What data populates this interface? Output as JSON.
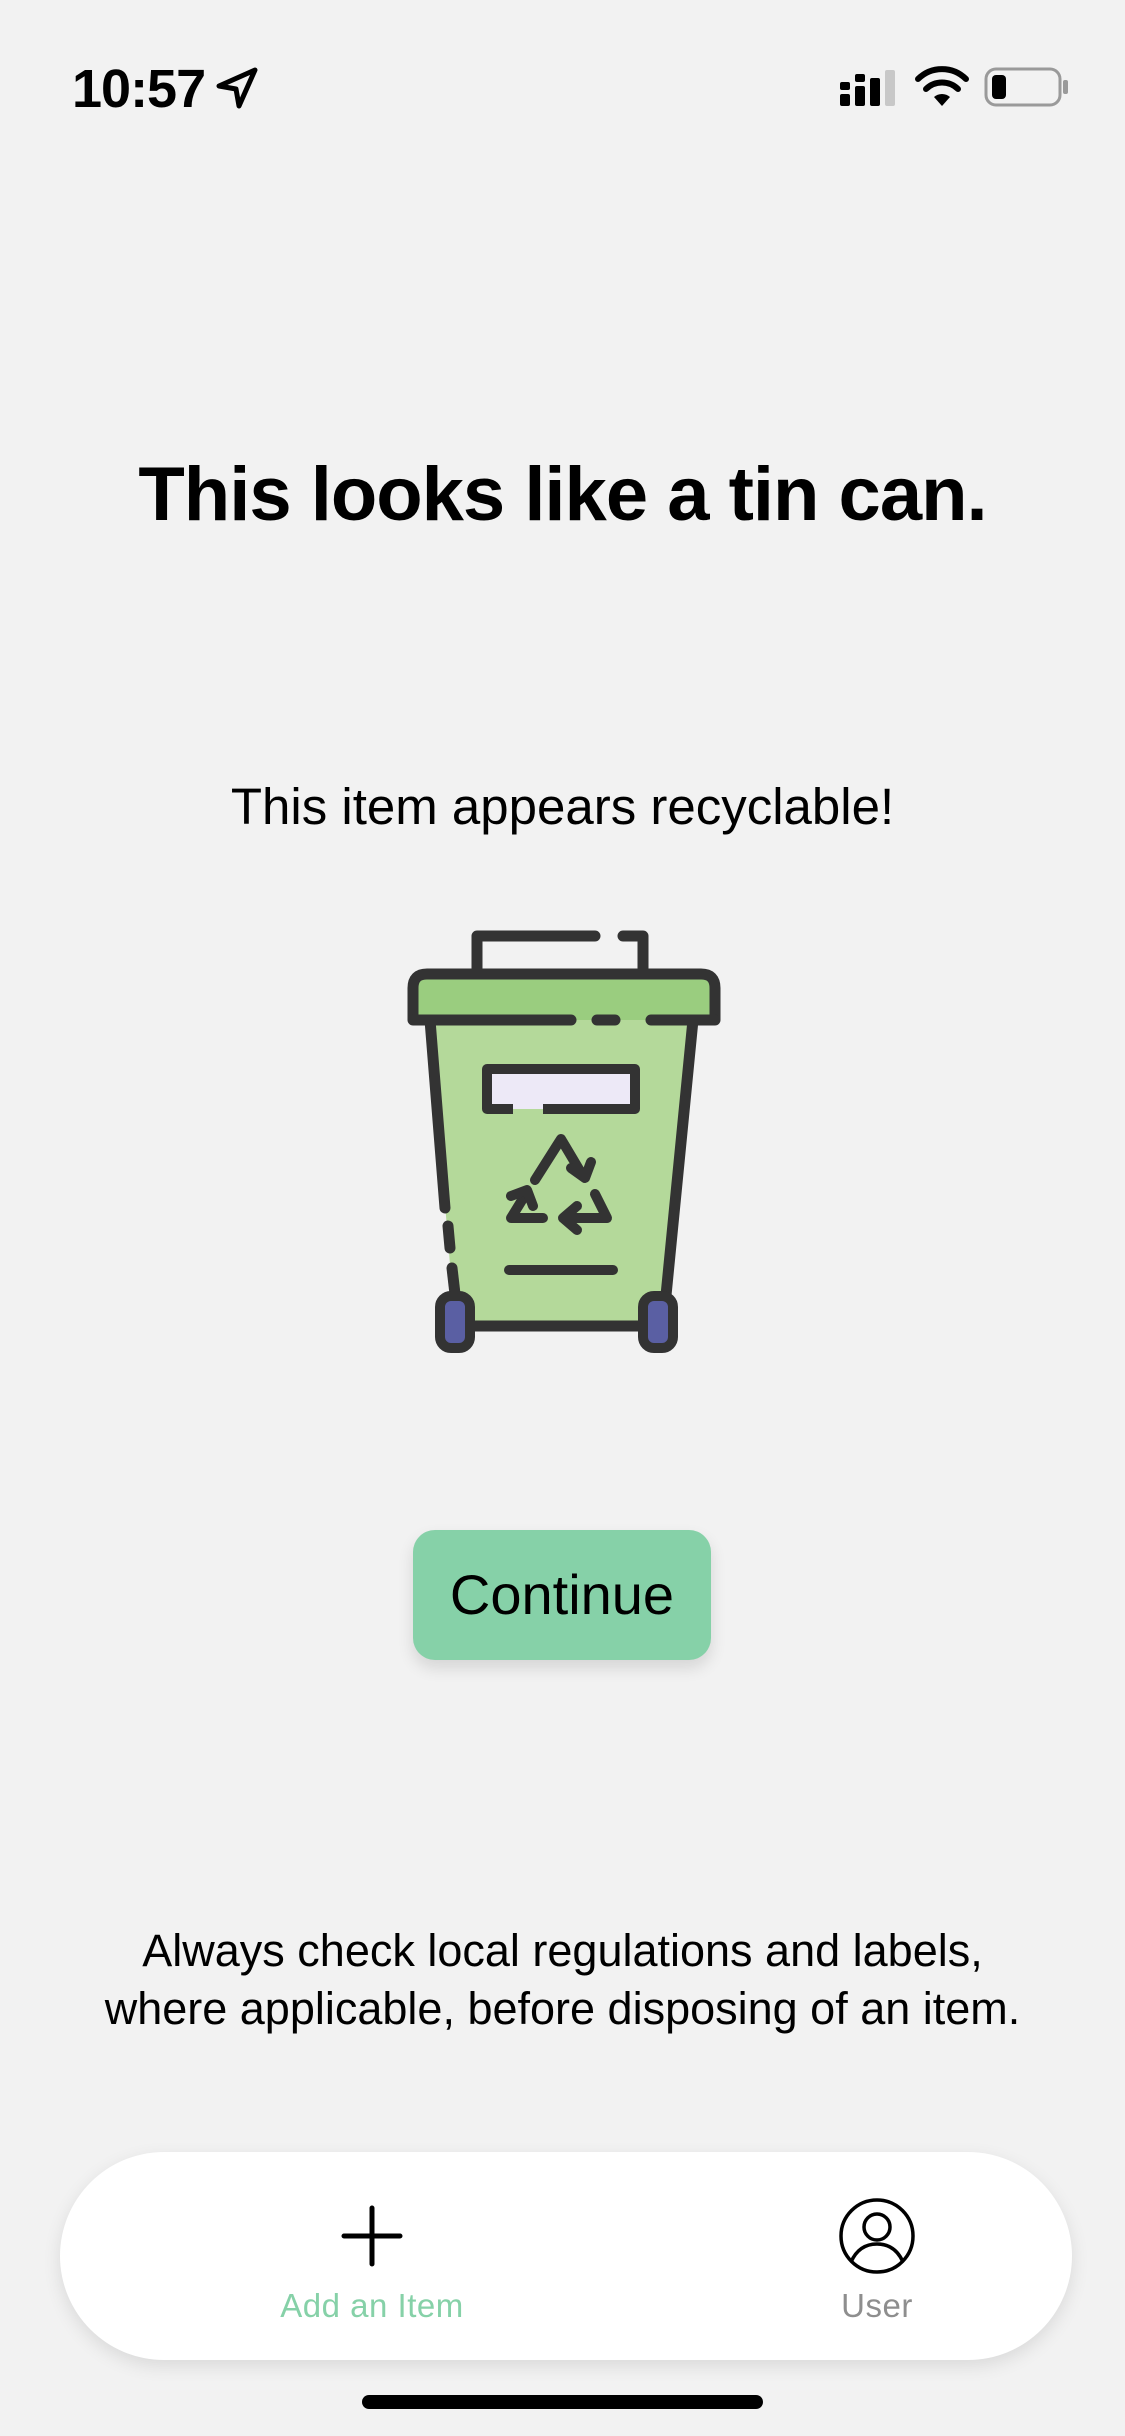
{
  "status_bar": {
    "time": "10:57",
    "icons": [
      "location-arrow-icon",
      "cellular-signal-icon",
      "wifi-icon",
      "battery-low-icon"
    ]
  },
  "result": {
    "headline": "This looks like a tin can.",
    "subheadline": "This item appears recyclable!",
    "illustration": "recycling-bin-icon"
  },
  "actions": {
    "continue_label": "Continue"
  },
  "disclaimer": {
    "line1": "Always check local regulations and labels,",
    "line2": "where applicable, before disposing of an item."
  },
  "tab_bar": {
    "add_item": {
      "label": "Add an Item",
      "icon": "plus-icon",
      "color": "#86d1a8"
    },
    "user": {
      "label": "User",
      "icon": "user-circle-icon",
      "color": "#8e8e8e"
    }
  },
  "colors": {
    "background": "#f2f2f2",
    "accent": "#86d1a8",
    "bin_body": "#b4d99a",
    "bin_lid": "#9acd7f",
    "wheels": "#5a5fa3"
  }
}
